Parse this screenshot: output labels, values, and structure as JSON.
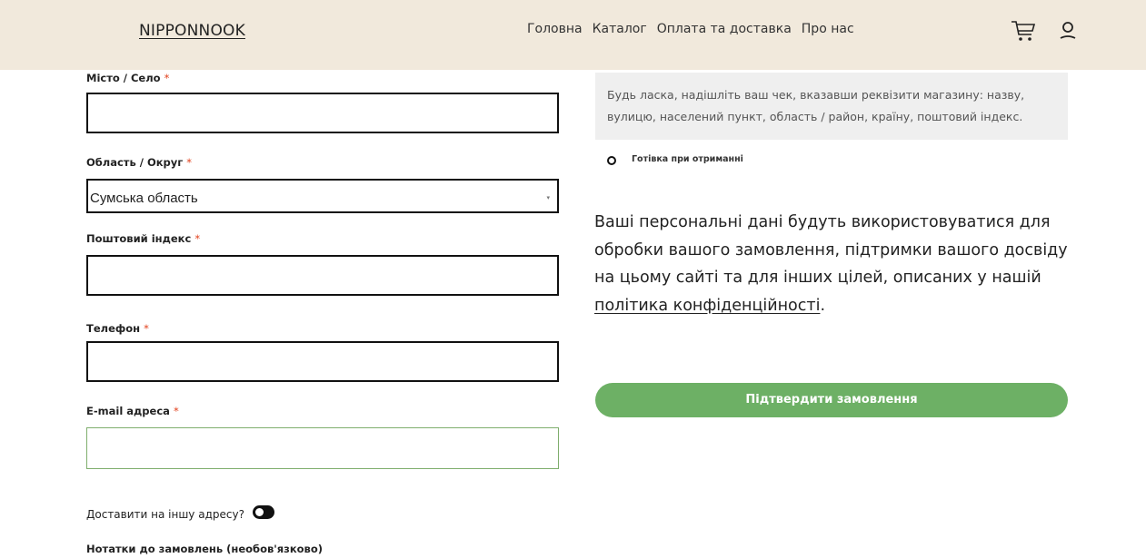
{
  "header": {
    "logo": "NIPPONNOOK",
    "nav": [
      "Головна",
      "Каталог",
      "Оплата та доставка",
      "Про нас"
    ],
    "icons": [
      "cart-icon",
      "user-icon"
    ]
  },
  "form": {
    "city_label": "Місто / Село",
    "city_value": "",
    "region_label": "Область / Округ",
    "region_value": "Сумська область",
    "postcode_label": "Поштовий індекс",
    "postcode_value": "",
    "phone_label": "Телефон",
    "phone_value": "",
    "email_label": "E-mail адреса",
    "email_value": "",
    "required_mark": "*",
    "ship_other_label": "Доставити на іншу адресу?",
    "notes_label": "Нотатки до замовлень (необов'язково)"
  },
  "payment": {
    "info_text": "Будь ласка, надішліть ваш чек, вказавши реквізити магазину: назву, вулицю, населений пункт, область / район, країну, поштовий індекс.",
    "cash_label": "Готівка при отриманні"
  },
  "privacy": {
    "text": "Ваші персональні дані будуть використовуватися для обробки вашого замовлення, підтримки вашого досвіду на цьому сайті та для інших цілей, описаних у нашій ",
    "link": "політика конфіденційності",
    "end": "."
  },
  "submit_label": "Підтвердити замовлення",
  "colors": {
    "header_bg": "#f1e9dc",
    "button_green": "#6db065",
    "required_red": "#e2401c",
    "info_bg": "#efefef"
  }
}
